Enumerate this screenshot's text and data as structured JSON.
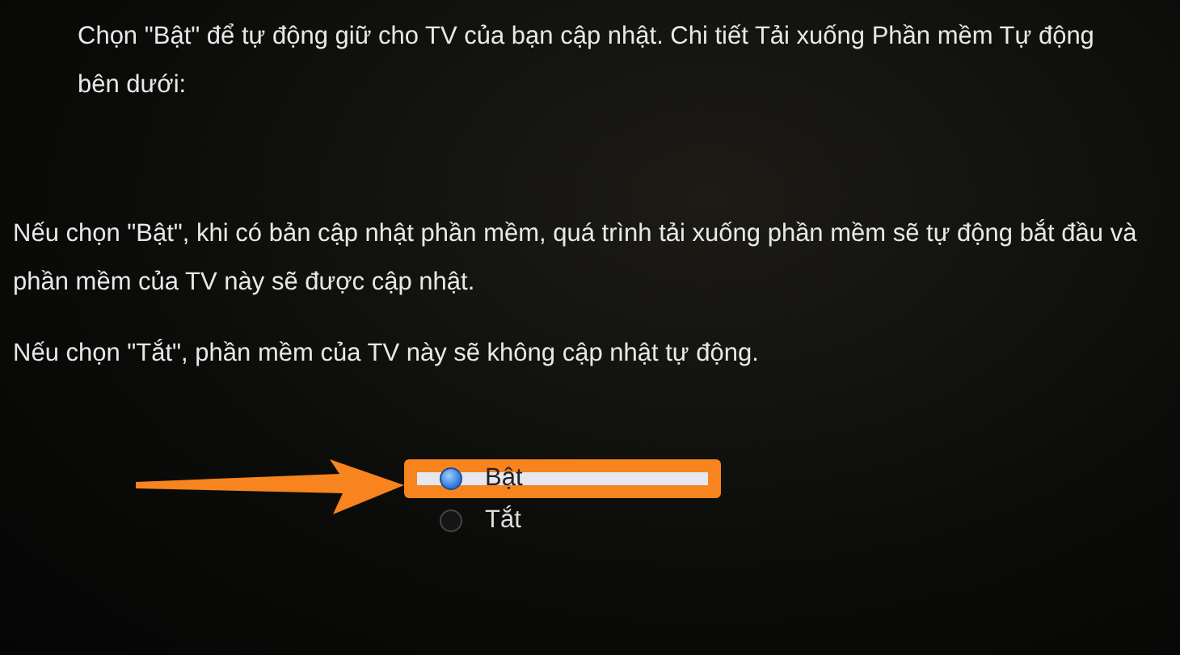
{
  "intro": "Chọn \"Bật\" để tự động giữ cho TV của bạn cập nhật. Chi tiết Tải xuống Phần mềm Tự động bên dưới:",
  "details": [
    "Nếu chọn \"Bật\", khi có bản cập nhật phần mềm, quá trình tải xuống phần mềm sẽ tự động bắt đầu và phần mềm của TV này sẽ được cập nhật.",
    "Nếu chọn \"Tắt\", phần mềm của TV này sẽ không cập nhật tự động."
  ],
  "options": [
    {
      "label": "Bật",
      "selected": true
    },
    {
      "label": "Tắt",
      "selected": false
    }
  ]
}
